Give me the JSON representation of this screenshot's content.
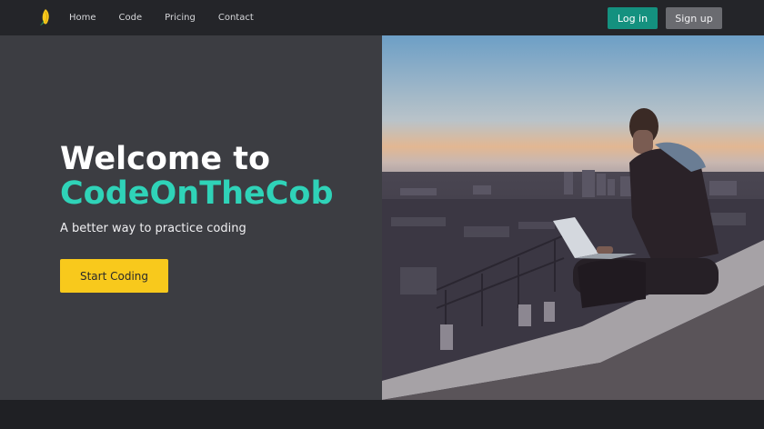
{
  "nav": {
    "logo_icon": "corn-icon",
    "links": [
      "Home",
      "Code",
      "Pricing",
      "Contact"
    ],
    "login_label": "Log in",
    "signup_label": "Sign up"
  },
  "hero": {
    "title_line1": "Welcome to",
    "brand": "CodeOnTheCob",
    "subtitle": "A better way to practice coding",
    "cta_label": "Start Coding"
  },
  "colors": {
    "accent_teal": "#14917f",
    "brand_text": "#2fd3b8",
    "cta_yellow": "#f8c91c",
    "panel_dark": "#3c3d42",
    "nav_bg": "#242529"
  }
}
